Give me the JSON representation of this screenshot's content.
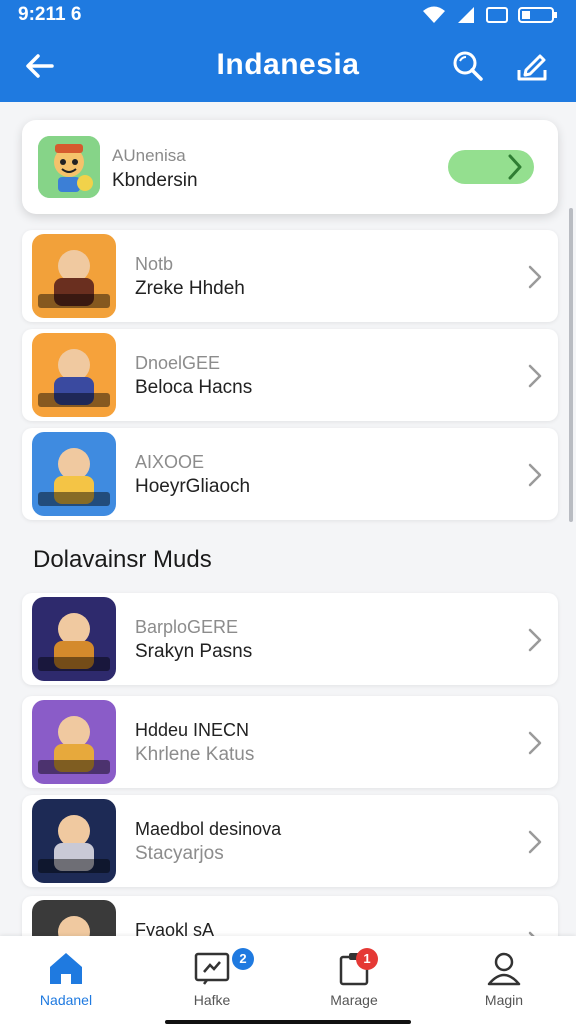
{
  "status_bar": {
    "time": "9:211 6"
  },
  "app_bar": {
    "title": "Indanesia"
  },
  "featured": {
    "subtitle": "AUnenisa",
    "name": "Kbndersin"
  },
  "top_list": [
    {
      "line1": "Notb",
      "line2": "Zreke Hhdeh",
      "thumb_colors": [
        "#f2a13a",
        "#6a2f1f"
      ]
    },
    {
      "line1": "DnoelGEE",
      "line2": "Beloca Hacns",
      "thumb_colors": [
        "#f6a23b",
        "#3a4aa0"
      ]
    },
    {
      "line1": "AIXOOE",
      "line2": "HoeyrGliaoch",
      "thumb_colors": [
        "#3f8be0",
        "#f4c445"
      ]
    }
  ],
  "section": {
    "title": "Dolavainsr Muds"
  },
  "mods_list": [
    {
      "line1": "BarploGERE",
      "line2": "Srakyn Pasns",
      "thumb_colors": [
        "#2e2a6d",
        "#d48a2c"
      ]
    },
    {
      "line1": "Hddeu INECN",
      "line2": "Khrlene Katus",
      "thumb_colors": [
        "#8a5cc8",
        "#e7a93c"
      ]
    },
    {
      "line1": "Maedbol desinova",
      "line2": "Stacyarjos",
      "thumb_colors": [
        "#1d2a55",
        "#c9c9d6"
      ]
    },
    {
      "line1": "Fyaokl sA",
      "line2": "",
      "thumb_colors": [
        "#3a3a3a",
        "#c0412f"
      ]
    }
  ],
  "bottom_nav": [
    {
      "label": "Nadanel",
      "active": true
    },
    {
      "label": "Hafke",
      "badge": "2",
      "badge_color": "#1f7ae0"
    },
    {
      "label": "Marage",
      "badge": "1",
      "badge_color": "#e53935"
    },
    {
      "label": "Magin"
    }
  ]
}
